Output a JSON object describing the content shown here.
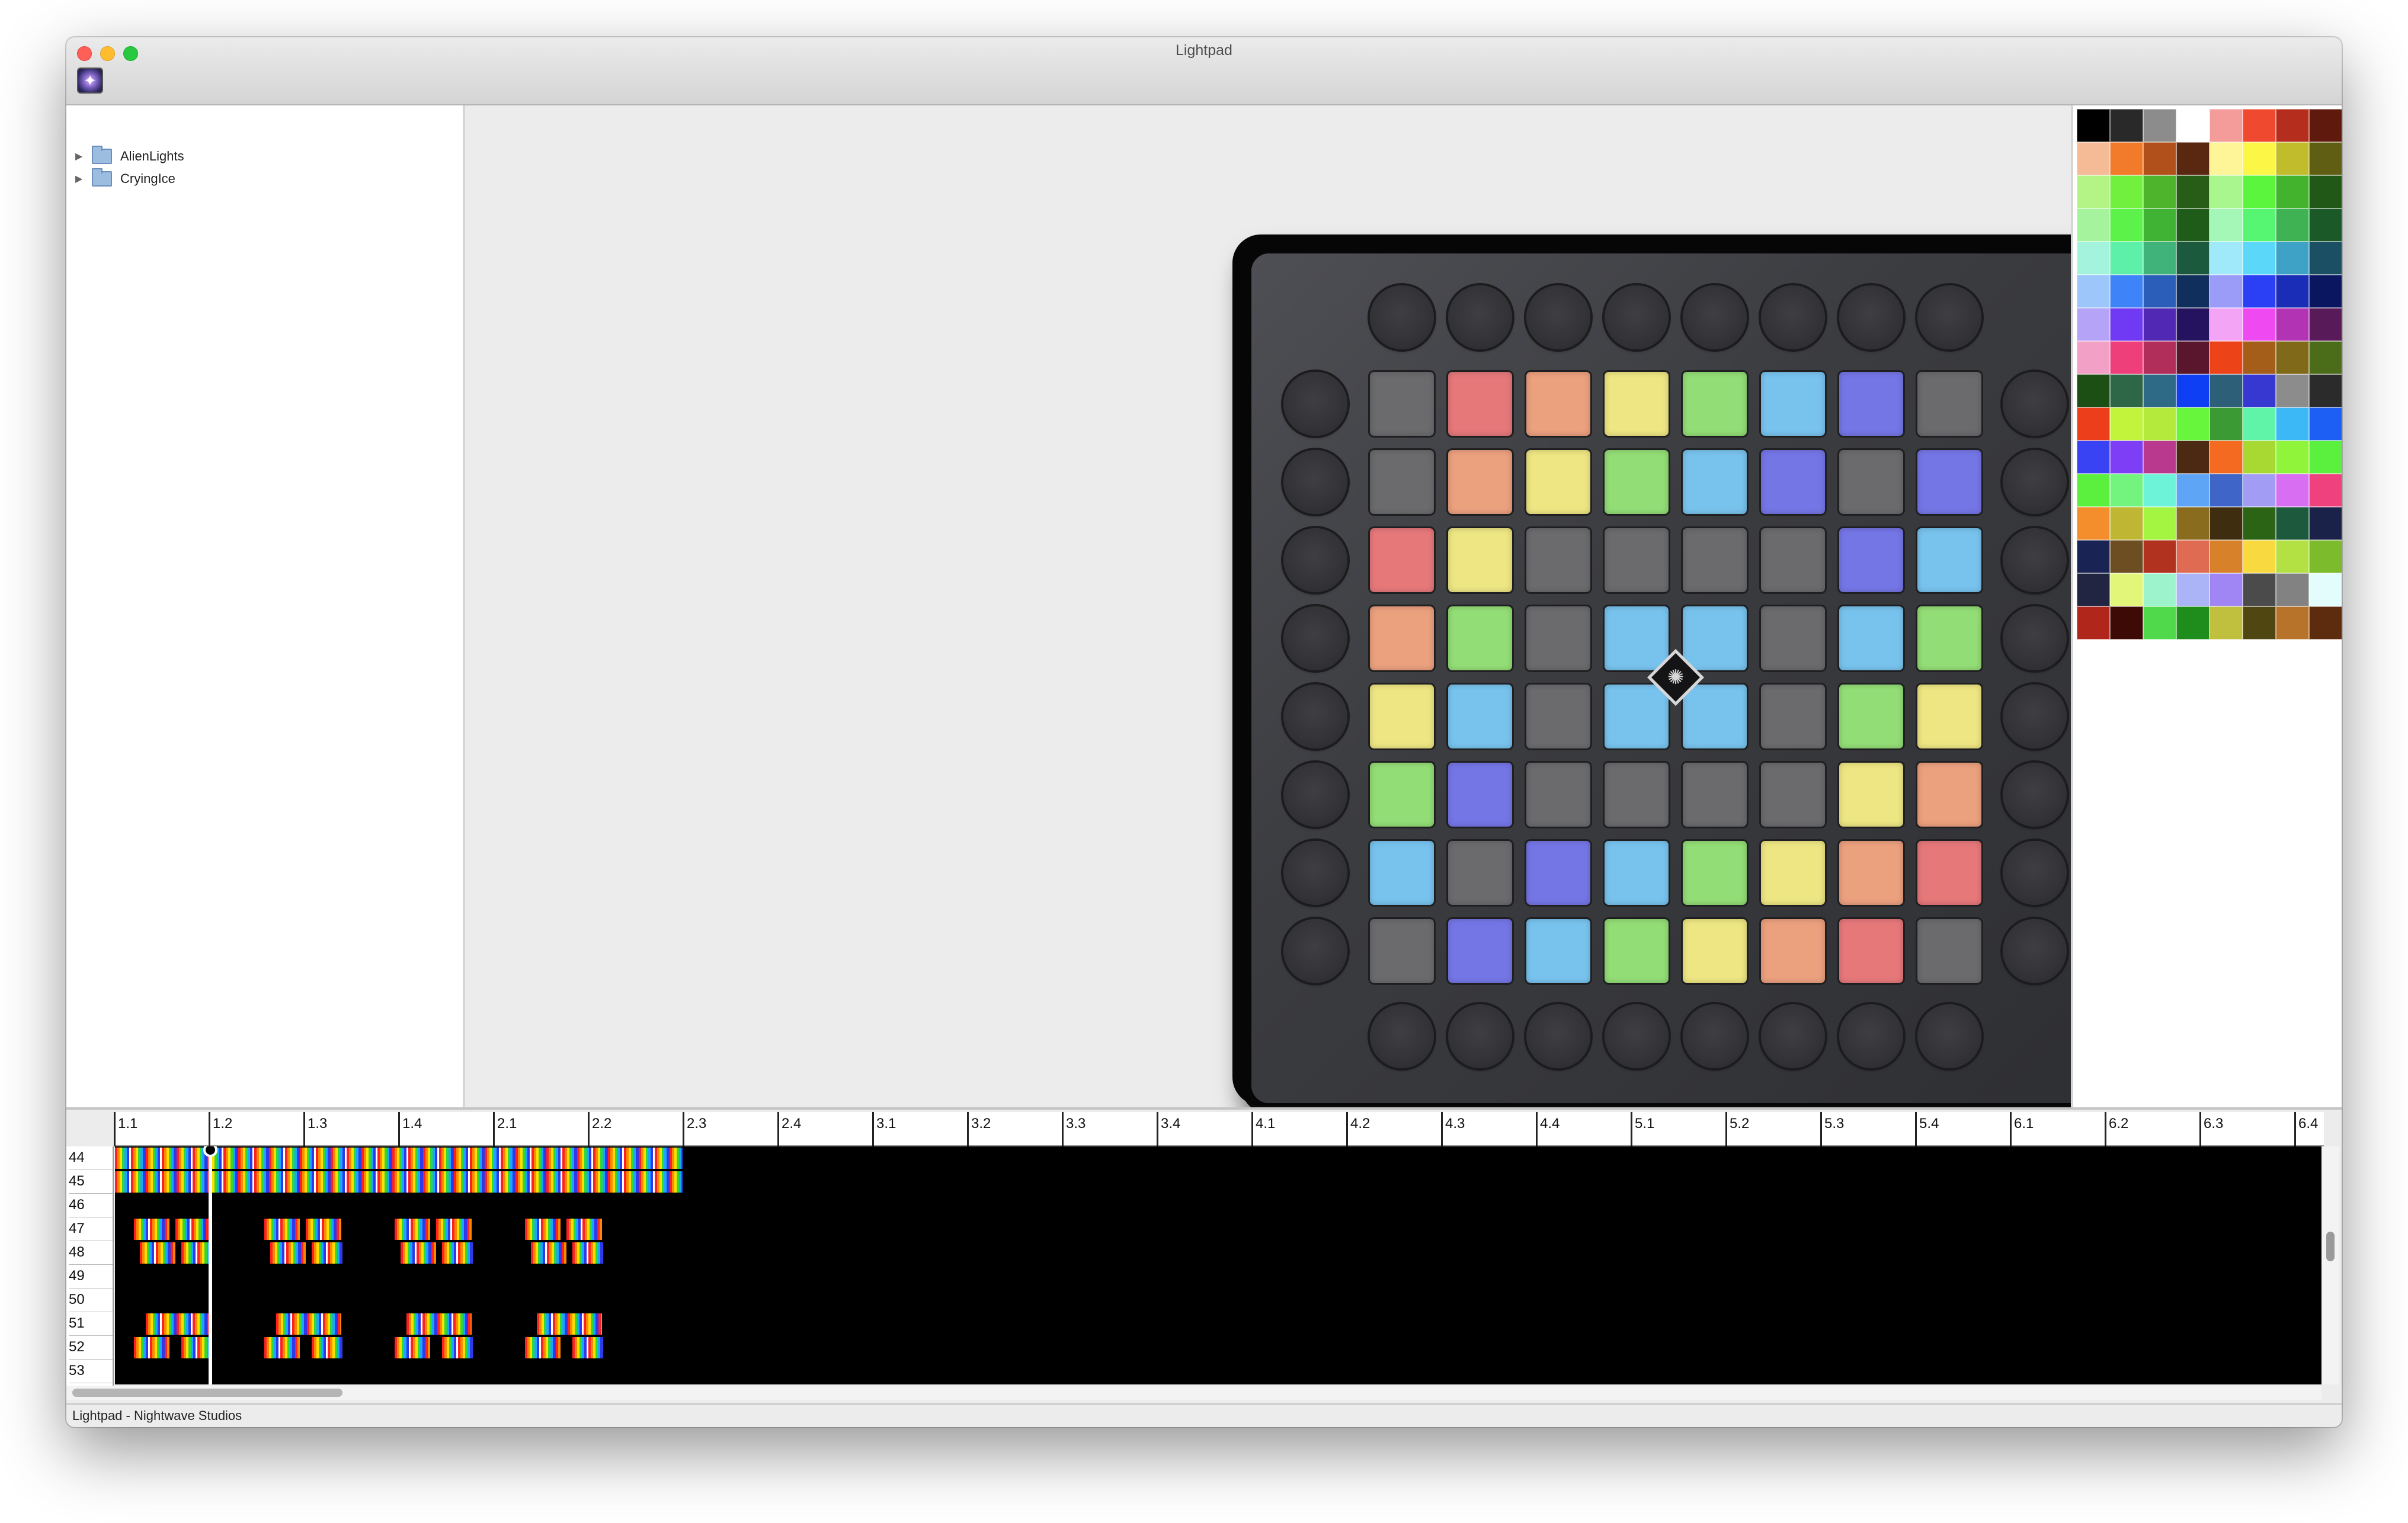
{
  "window": {
    "title": "Lightpad",
    "app_icon": "lightpad-app-icon"
  },
  "traffic_lights": {
    "close": "#fe5f57",
    "minimize": "#febc2e",
    "zoom": "#28c840"
  },
  "sidebar": {
    "items": [
      {
        "label": "AlienLights",
        "icon": "folder-icon",
        "expanded": false
      },
      {
        "label": "CryingIce",
        "icon": "folder-icon",
        "expanded": false
      }
    ]
  },
  "launchpad": {
    "center_logo_icon": "novation-logo-icon",
    "colors": {
      "O": "#6b6b6d",
      "R": "#e6787a",
      "A": "#eba07e",
      "Y": "#eee683",
      "G": "#93dd76",
      "B": "#78c3ee",
      "P": "#7576e6"
    },
    "grid": [
      "ORAYGBPO",
      "OAYGBPOP",
      "RYOOOOPB",
      "AGOBBOBG",
      "YBOBBOGY",
      "GPOOOOYA",
      "BOPBGYAR",
      "OPBGYARO"
    ]
  },
  "palette": {
    "swatches": [
      "#000000",
      "#292929",
      "#8c8c8c",
      "#ffffff",
      "#f49c9a",
      "#ef4a30",
      "#b52d1c",
      "#601a0d",
      "#f4bb96",
      "#f17a2b",
      "#b1501a",
      "#5a2710",
      "#fdf598",
      "#fcf646",
      "#c0bc2b",
      "#5f5e12",
      "#b4f486",
      "#71f13d",
      "#4db42b",
      "#275d16",
      "#a9f68e",
      "#5bf53e",
      "#43b32e",
      "#215717",
      "#a5f49d",
      "#5cf24a",
      "#41b334",
      "#1f5c1a",
      "#a4f7b6",
      "#56f572",
      "#3fb353",
      "#1b5a28",
      "#a4f3dc",
      "#5df0a8",
      "#3fb37a",
      "#1b5a3d",
      "#a0e9fb",
      "#5ad7f9",
      "#3ea2c7",
      "#1b4f64",
      "#9dc6fa",
      "#3e83f7",
      "#2a5eb8",
      "#112f5c",
      "#9a9cf8",
      "#2b3ff5",
      "#1a2db6",
      "#0b1660",
      "#b4a3f7",
      "#7039f3",
      "#5028b3",
      "#26135f",
      "#f3a4f4",
      "#ef49f1",
      "#b233b4",
      "#591a5a",
      "#f2a0c5",
      "#ee3f7b",
      "#b12d5a",
      "#5a162d",
      "#ec4318",
      "#a55e19",
      "#806a1a",
      "#4b6d1a",
      "#1c4f14",
      "#2e6648",
      "#2e6a86",
      "#0f3ff4",
      "#2d5f78",
      "#3738d1",
      "#8c8c8c",
      "#2b2b2b",
      "#ed3e1b",
      "#c1f43b",
      "#b3ea3b",
      "#67f63b",
      "#3c9a34",
      "#60f4a8",
      "#3db8f7",
      "#1d5ef5",
      "#3943f4",
      "#7d3ef5",
      "#b9398e",
      "#4c2912",
      "#f46a21",
      "#a8d933",
      "#90f43b",
      "#5af03d",
      "#5af03d",
      "#72f47f",
      "#6df4d8",
      "#5ea6f5",
      "#3e65c7",
      "#a29cf4",
      "#d86ef1",
      "#ef417e",
      "#f48d2c",
      "#bfb634",
      "#a3f541",
      "#8a6c1f",
      "#3e2e0f",
      "#2a6414",
      "#1d5a3d",
      "#1a2249",
      "#192454",
      "#6d4e22",
      "#b1321f",
      "#df6c52",
      "#d7812b",
      "#f8d93f",
      "#b3e043",
      "#7cbb2c",
      "#212542",
      "#e2f77a",
      "#9df4cc",
      "#abb4f7",
      "#9f86f4",
      "#4b4b4b",
      "#828282",
      "#e2fdfc",
      "#b1261a",
      "#3d0a05",
      "#50d94a",
      "#1e8d1c",
      "#c0c03e",
      "#4f4611",
      "#b8732a",
      "#5d2b0e"
    ]
  },
  "timeline": {
    "ruler_labels": [
      "1.1",
      "1.2",
      "1.3",
      "1.4",
      "2.1",
      "2.2",
      "2.3",
      "2.4",
      "3.1",
      "3.2",
      "3.3",
      "3.4",
      "4.1",
      "4.2",
      "4.3",
      "4.4",
      "5.1",
      "5.2",
      "5.3",
      "5.4",
      "6.1",
      "6.2",
      "6.3",
      "6.4"
    ],
    "row_labels": [
      "44",
      "45",
      "46",
      "47",
      "48",
      "49",
      "50",
      "51",
      "52",
      "53"
    ],
    "scroll_label": ""
  },
  "status_bar": {
    "text": "Lightpad - Nightwave Studios"
  }
}
